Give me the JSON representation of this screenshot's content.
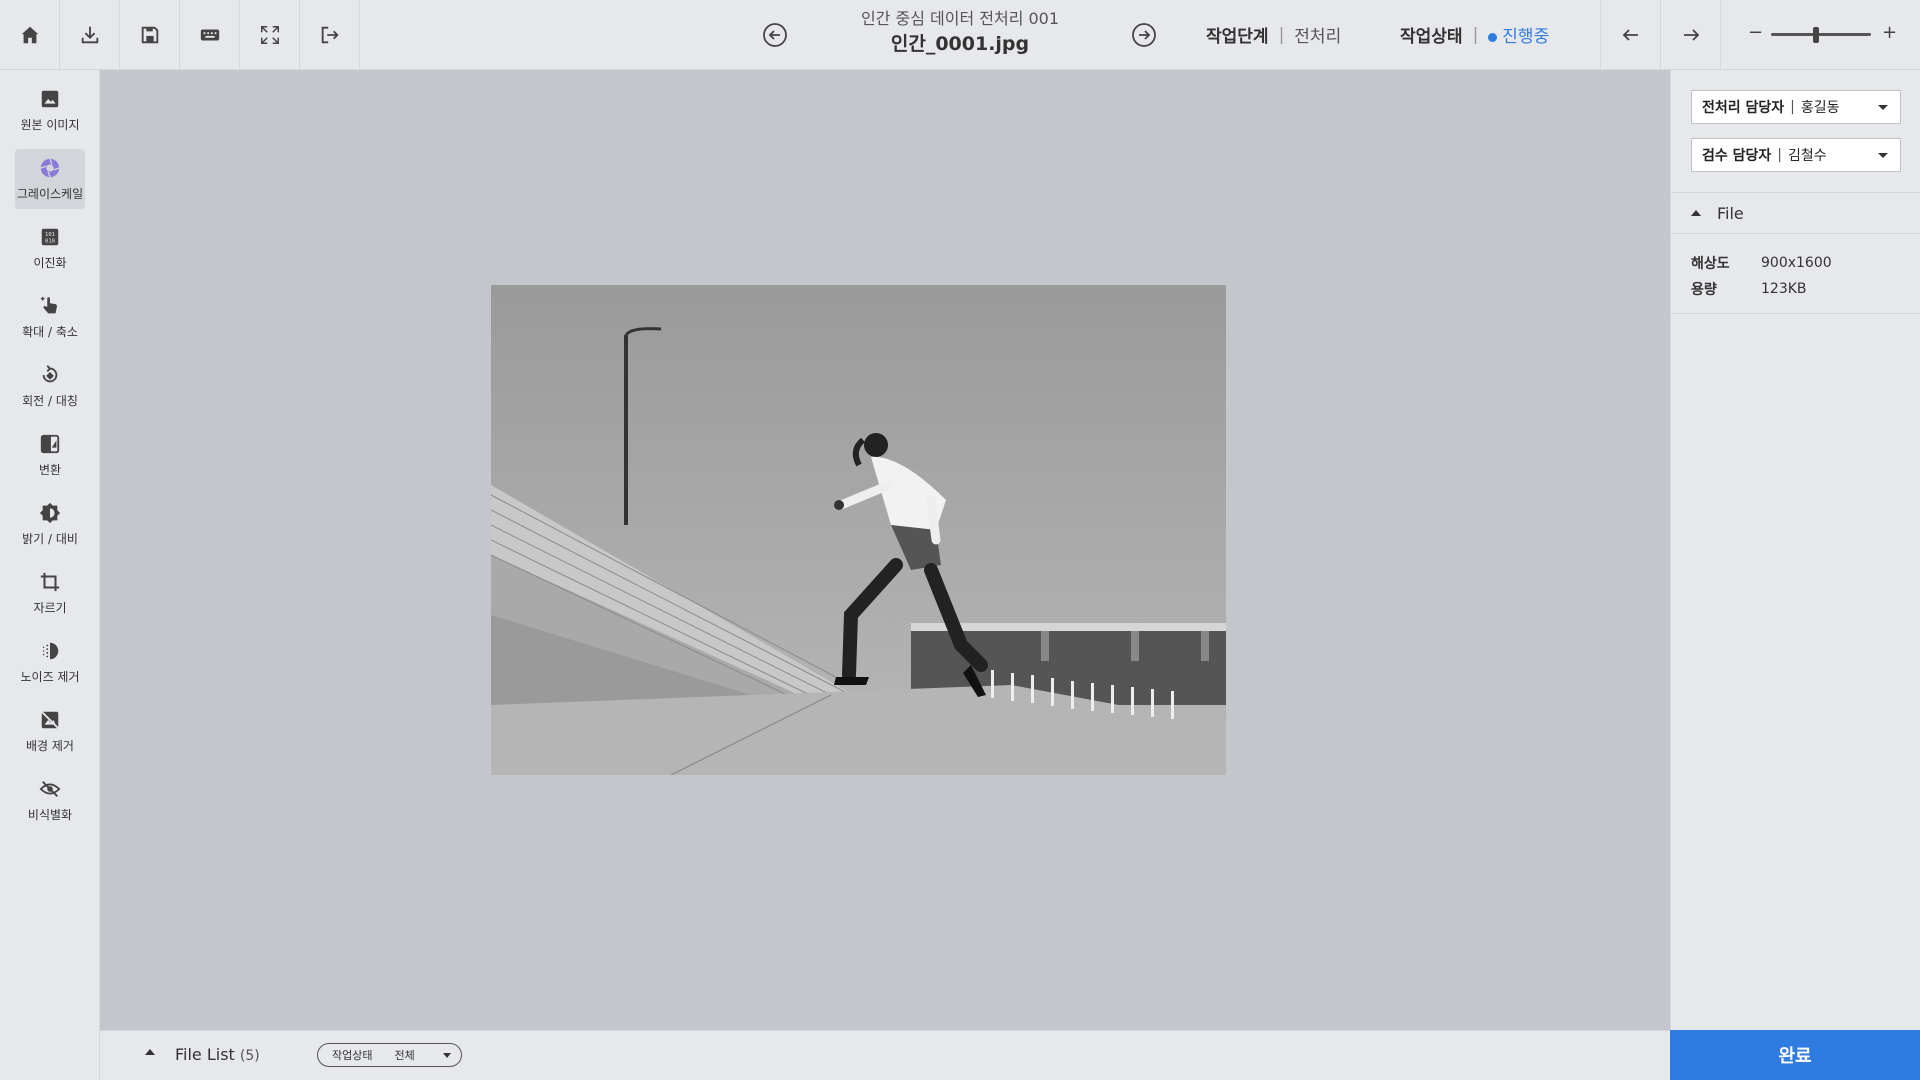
{
  "toolbar": {
    "buttons": [
      "home-icon",
      "download-icon",
      "save-icon",
      "keyboard-icon",
      "fullscreen-icon",
      "logout-icon"
    ]
  },
  "header": {
    "subtitle": "인간 중심 데이터 전처리 001",
    "filename": "인간_0001.jpg",
    "stage_label": "작업단계",
    "stage_value": "전처리",
    "status_label": "작업상태",
    "status_value": "진행중",
    "status_color": "#2f7be0"
  },
  "zoom": {
    "minus": "−",
    "plus": "+",
    "level": 0.45
  },
  "sidebar": {
    "items": [
      {
        "label": "원본 이미지",
        "icon": "image-icon",
        "active": false
      },
      {
        "label": "그레이스케일",
        "icon": "grayscale-icon",
        "active": true
      },
      {
        "label": "이진화",
        "icon": "binarize-icon",
        "active": false
      },
      {
        "label": "확대 / 축소",
        "icon": "zoom-gesture-icon",
        "active": false
      },
      {
        "label": "회전 / 대칭",
        "icon": "rotate-icon",
        "active": false
      },
      {
        "label": "변환",
        "icon": "flip-icon",
        "active": false
      },
      {
        "label": "밝기 / 대비",
        "icon": "brightness-icon",
        "active": false
      },
      {
        "label": "자르기",
        "icon": "crop-icon",
        "active": false
      },
      {
        "label": "노이즈 제거",
        "icon": "denoise-icon",
        "active": false
      },
      {
        "label": "배경 제거",
        "icon": "remove-background-icon",
        "active": false
      },
      {
        "label": "비식별화",
        "icon": "deidentify-icon",
        "active": false
      }
    ]
  },
  "right_panel": {
    "preprocessor": {
      "label": "전처리 담당자",
      "value": "홍길동"
    },
    "reviewer": {
      "label": "검수 담당자",
      "value": "김철수"
    },
    "section_title": "File",
    "resolution_label": "해상도",
    "resolution_value": "900x1600",
    "size_label": "용량",
    "size_value": "123KB"
  },
  "file_list": {
    "label": "File List",
    "count": "(5)",
    "filter_label": "작업상태",
    "filter_value": "전체"
  },
  "done_button": "완료",
  "accent_color": "#2f7be0"
}
